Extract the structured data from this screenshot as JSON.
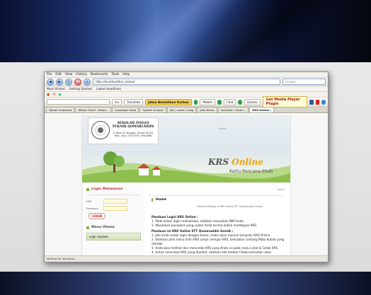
{
  "browser": {
    "menu": [
      "File",
      "Edit",
      "View",
      "History",
      "Bookmarks",
      "Tools",
      "Help"
    ],
    "address": "http://localhost/krs_online/",
    "search_placeholder": "Google",
    "bookmarks": [
      "Most Visited",
      "Getting Started",
      "Latest Headlines"
    ],
    "toolbar": {
      "go": "Go",
      "translate": "Translate",
      "hide": "Jaksa Bentahkan Korban",
      "mobile": "Mobile",
      "chat": "Chat",
      "games": "Games",
      "media": "Get Media Player Plugin"
    },
    "tabs": [
      {
        "label": "Yahoo! Indonesia"
      },
      {
        "label": "Yahoo! Email - Yahoo..."
      },
      {
        "label": "Lowongan Kerja"
      },
      {
        "label": "System Analyst"
      },
      {
        "label": "Job | career | blog"
      },
      {
        "label": "Jobs Demo"
      },
      {
        "label": "localhost / localh..."
      },
      {
        "label": "KRS Online |"
      }
    ],
    "status": "Waiting for localhost..."
  },
  "page": {
    "school_name": "SEKOLAH TINGGI TEKNIK QOMARUDDIN",
    "school_address": "Jl. Raya 01 Bungah, Gresik 61152\nTelp. (031) 3327376 / 3943386",
    "header_link": "Gresik",
    "title_part1": "KRS ",
    "title_part2": "Online",
    "subtitle": "Kartu Rencana Studi",
    "login_heading": "Login Mahasiswa",
    "nim_label": "NIM",
    "password_label": "Password",
    "login_button": "LOGIN",
    "menu_heading": "Menu Utama",
    "menu_item": "Login System",
    "home_link": "Home",
    "home_title": "Home",
    "welcome": "Selamat Datang di KRS Online STT Qomaruddin Gresik",
    "steps_heading": "Panduan Login KRS Online :",
    "steps": [
      "1. Pada kolom login mahasiswa, silahkan masukkan NIM Anda.",
      "2. Masukkan password yang sudah Anda terima ketika membayar KRS."
    ],
    "guide_heading": "Panduan isi KRS Online STT Qomaruddin Gresik :",
    "guide": [
      "1. Jika anda sudah login dengan benar, maka akan muncul tampilan KRS Online",
      "2. Silahkan pilih menu Entri KRS untuk mengisi KRS, kemudian centang Mata Kuliah yang diambil.",
      "3. Anda bisa melihat dan mencetak KRS yang Anda isi pada menu Lihat & Cetak KRS",
      "4. Untuk mencetak KRS yang diambil, silahkan klik tombol Cetak kemudian akan"
    ]
  }
}
